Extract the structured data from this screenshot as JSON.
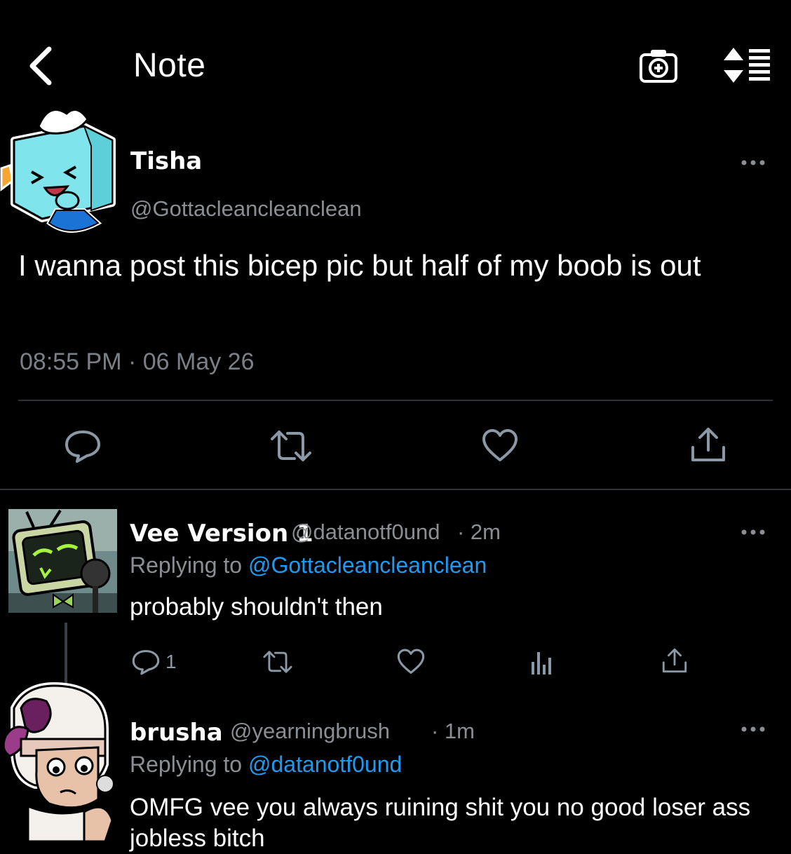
{
  "header": {
    "title": "Note"
  },
  "main_post": {
    "author_name": "Tisha",
    "handle": "@Gottacleancleanclean",
    "body": "I wanna post this bicep pic but half of my boob is out",
    "timestamp": "08:55 PM · 06 May 26"
  },
  "replies": [
    {
      "author_name": "Vee Version 1",
      "handle": "@datanotf0und",
      "time": "· 2m",
      "replying_prefix": "Replying to",
      "replying_to": "@Gottacleancleanclean",
      "text": "probably shouldn't then",
      "reply_count": "1"
    },
    {
      "author_name": "brusha",
      "handle": "@yearningbrush",
      "time": "· 1m",
      "replying_prefix": "Replying to",
      "replying_to": "@datanotf0und",
      "text": "OMFG vee you always ruining shit you no good loser ass jobless bitch"
    }
  ],
  "colors": {
    "background": "#000000",
    "link": "#1d9bf0",
    "muted": "#8b8f94",
    "divider": "#2f3336"
  },
  "icons": [
    "back-icon",
    "camera-add-icon",
    "sort-icon",
    "more-icon",
    "reply-icon",
    "retweet-icon",
    "like-icon",
    "share-icon",
    "analytics-icon"
  ]
}
